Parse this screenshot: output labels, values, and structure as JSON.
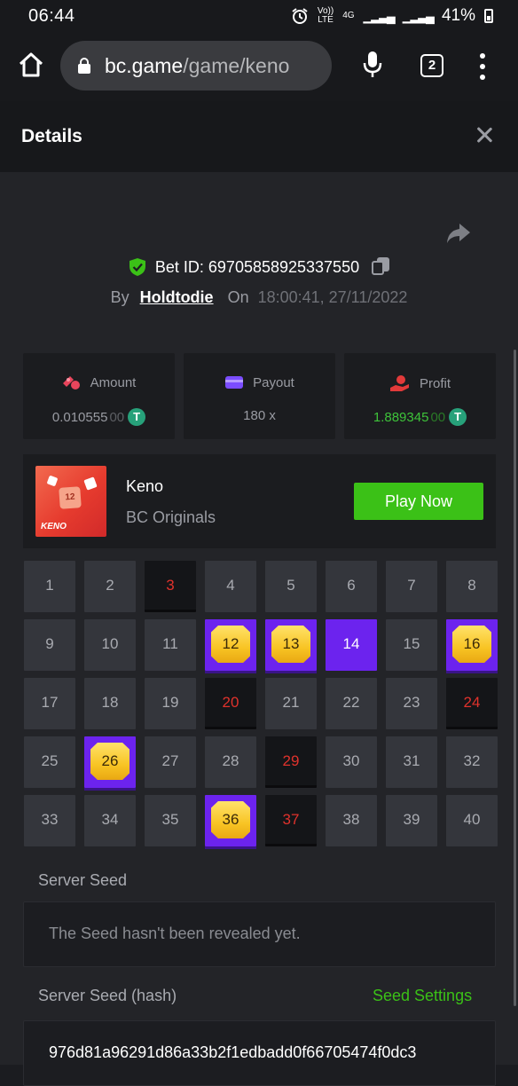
{
  "status": {
    "time": "06:44",
    "network_small_top": "Vo))",
    "network_small_bottom": "LTE",
    "gen": "4G",
    "battery": "41%"
  },
  "browser": {
    "url_host": "bc.game",
    "url_path": "/game/keno",
    "tab_count": "2"
  },
  "header": {
    "title": "Details"
  },
  "bet": {
    "id_label": "Bet ID: 69705858925337550",
    "by_label": "By",
    "user": "Holdtodie",
    "on_label": "On",
    "datetime": "18:00:41, 27/11/2022"
  },
  "stats": {
    "amount": {
      "label": "Amount",
      "value_main": "0.010555",
      "value_dim": "00",
      "currency": "T"
    },
    "payout": {
      "label": "Payout",
      "value": "180 x"
    },
    "profit": {
      "label": "Profit",
      "value_main": "1.889345",
      "value_dim": "00",
      "currency": "T"
    }
  },
  "game": {
    "thumb_number": "12",
    "thumb_word": "KENO",
    "name": "Keno",
    "provider": "BC Originals",
    "play_label": "Play Now"
  },
  "grid": {
    "cells": [
      {
        "n": "1",
        "state": "normal"
      },
      {
        "n": "2",
        "state": "normal"
      },
      {
        "n": "3",
        "state": "miss"
      },
      {
        "n": "4",
        "state": "normal"
      },
      {
        "n": "5",
        "state": "normal"
      },
      {
        "n": "6",
        "state": "normal"
      },
      {
        "n": "7",
        "state": "normal"
      },
      {
        "n": "8",
        "state": "normal"
      },
      {
        "n": "9",
        "state": "normal"
      },
      {
        "n": "10",
        "state": "normal"
      },
      {
        "n": "11",
        "state": "normal"
      },
      {
        "n": "12",
        "state": "hit"
      },
      {
        "n": "13",
        "state": "hit"
      },
      {
        "n": "14",
        "state": "selected"
      },
      {
        "n": "15",
        "state": "normal"
      },
      {
        "n": "16",
        "state": "hit"
      },
      {
        "n": "17",
        "state": "normal"
      },
      {
        "n": "18",
        "state": "normal"
      },
      {
        "n": "19",
        "state": "normal"
      },
      {
        "n": "20",
        "state": "miss"
      },
      {
        "n": "21",
        "state": "normal"
      },
      {
        "n": "22",
        "state": "normal"
      },
      {
        "n": "23",
        "state": "normal"
      },
      {
        "n": "24",
        "state": "miss"
      },
      {
        "n": "25",
        "state": "normal"
      },
      {
        "n": "26",
        "state": "hit"
      },
      {
        "n": "27",
        "state": "normal"
      },
      {
        "n": "28",
        "state": "normal"
      },
      {
        "n": "29",
        "state": "miss"
      },
      {
        "n": "30",
        "state": "normal"
      },
      {
        "n": "31",
        "state": "normal"
      },
      {
        "n": "32",
        "state": "normal"
      },
      {
        "n": "33",
        "state": "normal"
      },
      {
        "n": "34",
        "state": "normal"
      },
      {
        "n": "35",
        "state": "normal"
      },
      {
        "n": "36",
        "state": "hit"
      },
      {
        "n": "37",
        "state": "miss"
      },
      {
        "n": "38",
        "state": "normal"
      },
      {
        "n": "39",
        "state": "normal"
      },
      {
        "n": "40",
        "state": "normal"
      }
    ]
  },
  "seed": {
    "server_seed_label": "Server Seed",
    "server_seed_value": "The Seed hasn't been revealed yet.",
    "hash_label": "Server Seed (hash)",
    "seed_settings": "Seed Settings",
    "hash_value": "976d81a96291d86a33b2f1edbadd0f66705474f0dc3"
  },
  "colors": {
    "accent_purple": "#6c23ee",
    "accent_green": "#3bc117",
    "miss_red": "#e0322c",
    "background": "#232428"
  },
  "icons": {
    "home": "home-icon",
    "lock": "lock-icon",
    "mic": "mic-icon",
    "menu": "more-vert-icon",
    "close": "close-icon",
    "share": "share-icon",
    "shield": "shield-check-icon",
    "copy": "copy-icon",
    "amount": "coins-icon",
    "payout": "wallet-icon",
    "profit": "hand-money-icon",
    "usdt": "usdt-coin-icon",
    "gem": "gold-gem-icon"
  }
}
